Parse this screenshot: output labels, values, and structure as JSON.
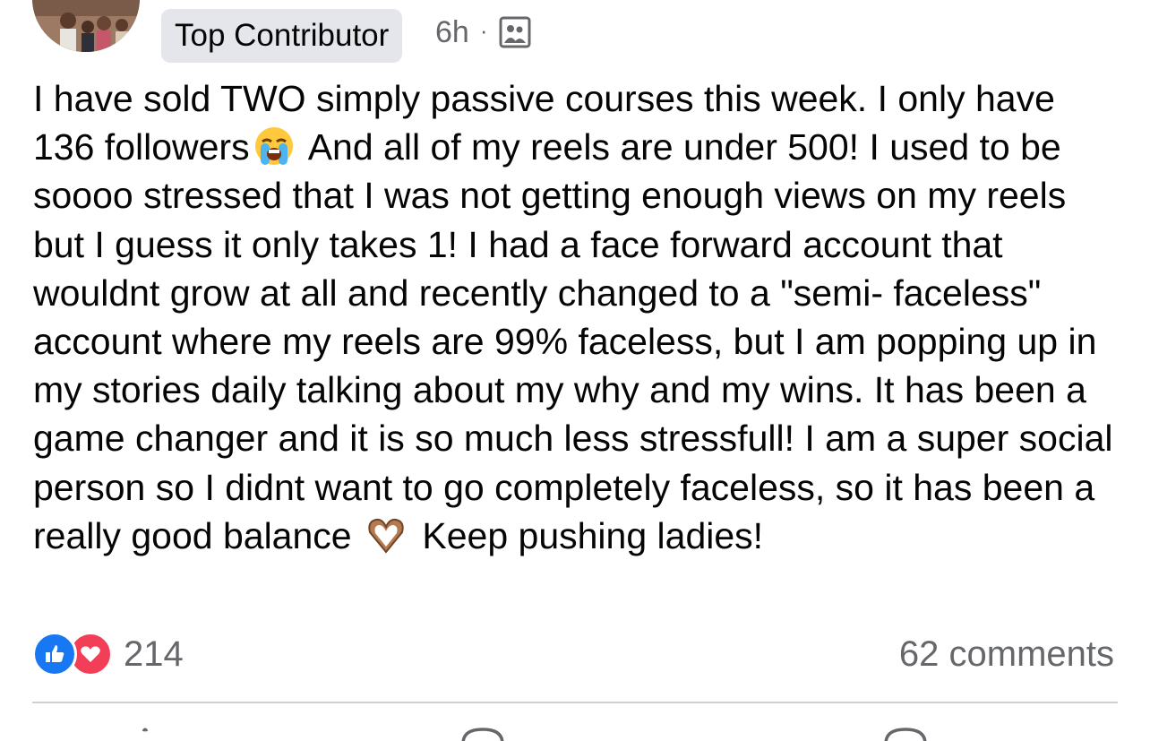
{
  "post": {
    "author_badge": "Top Contributor",
    "timestamp": "6h",
    "separator": "·",
    "audience_icon": "group-audience-icon",
    "text_part1": "I have sold TWO simply passive courses this week. I only have 136 followers",
    "emoji1": "loudly-crying-face-emoji",
    "text_part2": " And all of my reels are under 500! I used to be soooo stressed that I was not getting enough views on my reels but I guess it only takes 1! I had a face forward account that wouldnt grow at all and recently changed to a \"semi- faceless\" account where my reels are 99% faceless, but I am popping up in my stories daily talking about my why and my wins. It has been a game changer and it is so much less stressfull! I am a super social person so I didnt want to go completely faceless, so it has been a really good balance ",
    "emoji2": "heart-hands-emoji",
    "text_part3": " Keep pushing ladies!"
  },
  "engagement": {
    "reaction_icons": [
      "like-icon",
      "love-icon"
    ],
    "reaction_count": "214",
    "comments_count": "62 comments"
  },
  "colors": {
    "badge_bg": "#e4e6eb",
    "secondary_text": "#65676b",
    "like_blue": "#1877f2",
    "love_red": "#f33e58",
    "divider": "#ced0d4"
  }
}
